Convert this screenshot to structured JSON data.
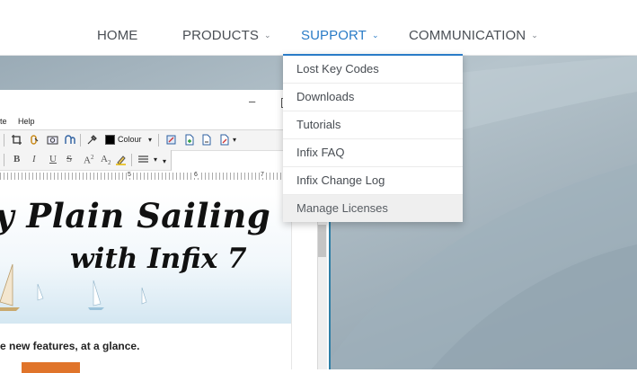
{
  "nav": {
    "items": [
      {
        "label": "HOME",
        "has_chevron": false
      },
      {
        "label": "PRODUCTS",
        "has_chevron": true
      },
      {
        "label": "SUPPORT",
        "has_chevron": true,
        "active": true
      },
      {
        "label": "COMMUNICATION",
        "has_chevron": true
      }
    ],
    "chevron": "⌄",
    "accent_color": "#2a7cc7"
  },
  "support_menu": {
    "items": [
      {
        "label": "Lost Key Codes"
      },
      {
        "label": "Downloads"
      },
      {
        "label": "Tutorials"
      },
      {
        "label": "Infix FAQ"
      },
      {
        "label": "Infix Change Log"
      },
      {
        "label": "Manage Licenses",
        "highlighted": true
      }
    ]
  },
  "app_window": {
    "minimize_glyph": "–",
    "menu": [
      "te",
      "Help"
    ],
    "toolbar": {
      "colour_label": "Colour",
      "format_buttons": [
        "B",
        "I",
        "U",
        "S",
        "A",
        "A"
      ],
      "superscript": "2",
      "subscript": "2",
      "icons": [
        "crop-icon",
        "link-icon",
        "camera-icon",
        "undo-icon",
        "eyedropper-icon",
        "color-swatch-icon",
        "page-add-icon",
        "page-icon",
        "page-edit-icon",
        "align-icon"
      ]
    },
    "ruler_marks": [
      "5",
      "6",
      "7"
    ],
    "document": {
      "banner_line1": "y Plain Sailing",
      "banner_line2": "with Infix 7",
      "caption": "e new features, at a glance.",
      "button_color": "#e0742a"
    }
  }
}
